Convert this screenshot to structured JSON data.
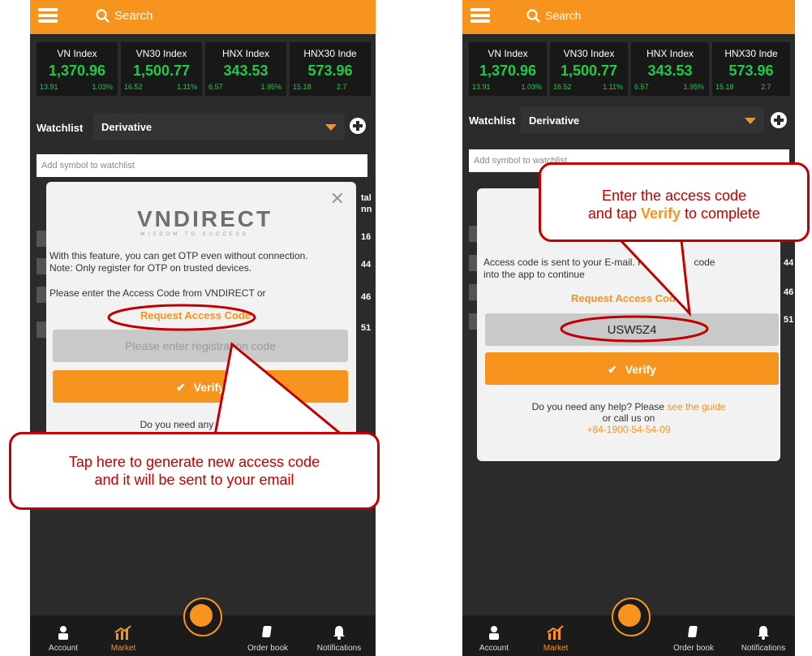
{
  "search": {
    "placeholder": "Search"
  },
  "indices": [
    {
      "name": "VN Index",
      "value": "1,370.96",
      "change": "13.91",
      "pct": "1.03%"
    },
    {
      "name": "VN30 Index",
      "value": "1,500.77",
      "change": "16.52",
      "pct": "1.11%"
    },
    {
      "name": "HNX Index",
      "value": "343.53",
      "change": "6.57",
      "pct": "1.95%"
    },
    {
      "name": "HNX30 Inde",
      "value": "573.96",
      "change": "15.18",
      "pct": "2.7"
    }
  ],
  "watchlist": {
    "label": "Watchlist",
    "selected": "Derivative",
    "add_placeholder": "Add symbol to watchlist"
  },
  "rows_left": [
    "16",
    "44",
    "46",
    "51"
  ],
  "rows_right": [
    "44",
    "46",
    "51"
  ],
  "col_left": "tal",
  "col_left2": "nn",
  "left_modal": {
    "logo": "VNDIRECT",
    "tagline": "WISDOM TO SUCCESS",
    "line1": "With this feature, you can get OTP even without connection.",
    "line2": "Note: Only register for OTP on trusted devices.",
    "line3": "Please enter the Access Code from VNDIRECT or",
    "request_link": "Request Access Code",
    "code_placeholder": "Please enter registration code",
    "verify": "Verify",
    "help": "Do you need any help? Plea"
  },
  "right_modal": {
    "line1": "Access code is sent to your E-mail. Please in",
    "line1b": "code",
    "line2": "into the app to continue",
    "request_link": "Request Access Code",
    "code_value": "USW5Z4",
    "verify": "Verify",
    "help1": "Do you need any help? Please ",
    "help_link": "see the guide",
    "help2": "or call us on",
    "phone": "+84-1900-54-54-09"
  },
  "nav": {
    "account": "Account",
    "market": "Market",
    "orderbook": "Order book",
    "notifications": "Notifications"
  },
  "callouts": {
    "left_line1": "Tap here to generate new access code",
    "left_line2": "and it will be sent to your email",
    "right_line1": "Enter the access code",
    "right_line2a": "and tap ",
    "right_line2b": "Verify",
    "right_line2c": " to complete"
  },
  "colors": {
    "accent": "#f7941d",
    "positive": "#22c94a",
    "callout": "#c00000",
    "panel": "#2b2b2b"
  },
  "icons": [
    "hamburger-icon",
    "search-icon",
    "plus-icon",
    "close-icon",
    "check-icon",
    "account-icon",
    "market-icon",
    "cart-icon",
    "orderbook-icon",
    "bell-icon"
  ]
}
